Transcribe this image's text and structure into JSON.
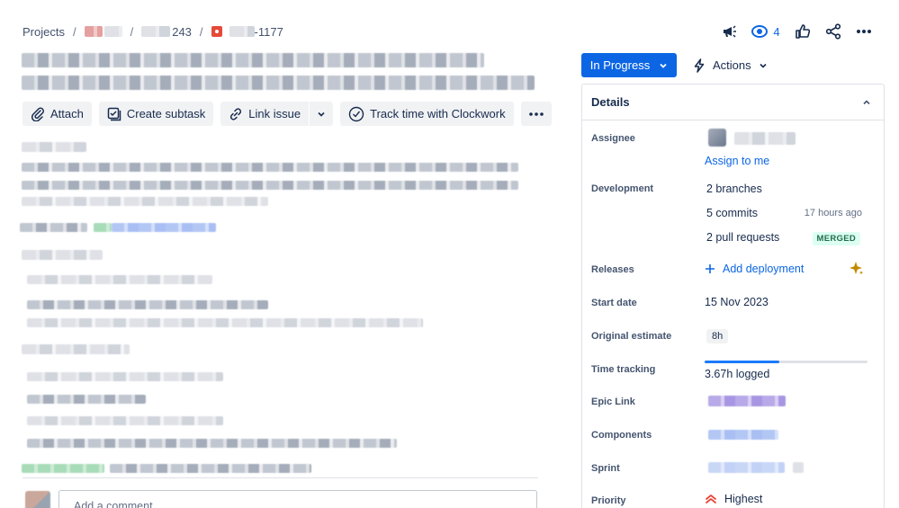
{
  "breadcrumb": {
    "projects_label": "Projects",
    "separator": "/",
    "parent_issue_suffix": "243",
    "issue_suffix": "-1177"
  },
  "header_actions": {
    "watch_count": "4",
    "icons": [
      "megaphone-icon",
      "eye-icon",
      "thumbs-up-icon",
      "share-icon",
      "more-icon"
    ]
  },
  "toolbar": {
    "attach_label": "Attach",
    "create_subtask_label": "Create subtask",
    "link_issue_label": "Link issue",
    "track_time_label": "Track time with Clockwork"
  },
  "status": {
    "label": "In Progress",
    "color": "#0c66e4"
  },
  "actions": {
    "label": "Actions"
  },
  "details": {
    "title": "Details",
    "assignee": {
      "label": "Assignee",
      "assign_to_me": "Assign to me"
    },
    "development": {
      "label": "Development",
      "branches": "2 branches",
      "commits": "5 commits",
      "commits_time": "17 hours ago",
      "pull_requests": "2 pull requests",
      "pr_status": "MERGED"
    },
    "releases": {
      "label": "Releases",
      "add_deployment": "Add deployment"
    },
    "start_date": {
      "label": "Start date",
      "value": "15 Nov 2023"
    },
    "original_estimate": {
      "label": "Original estimate",
      "value": "8h"
    },
    "time_tracking": {
      "label": "Time tracking",
      "logged": "3.67h logged",
      "progress_fraction": 0.46
    },
    "epic_link": {
      "label": "Epic Link"
    },
    "components": {
      "label": "Components"
    },
    "sprint": {
      "label": "Sprint"
    },
    "priority": {
      "label": "Priority",
      "value": "Highest"
    }
  },
  "comment": {
    "placeholder": "Add a comment..."
  }
}
